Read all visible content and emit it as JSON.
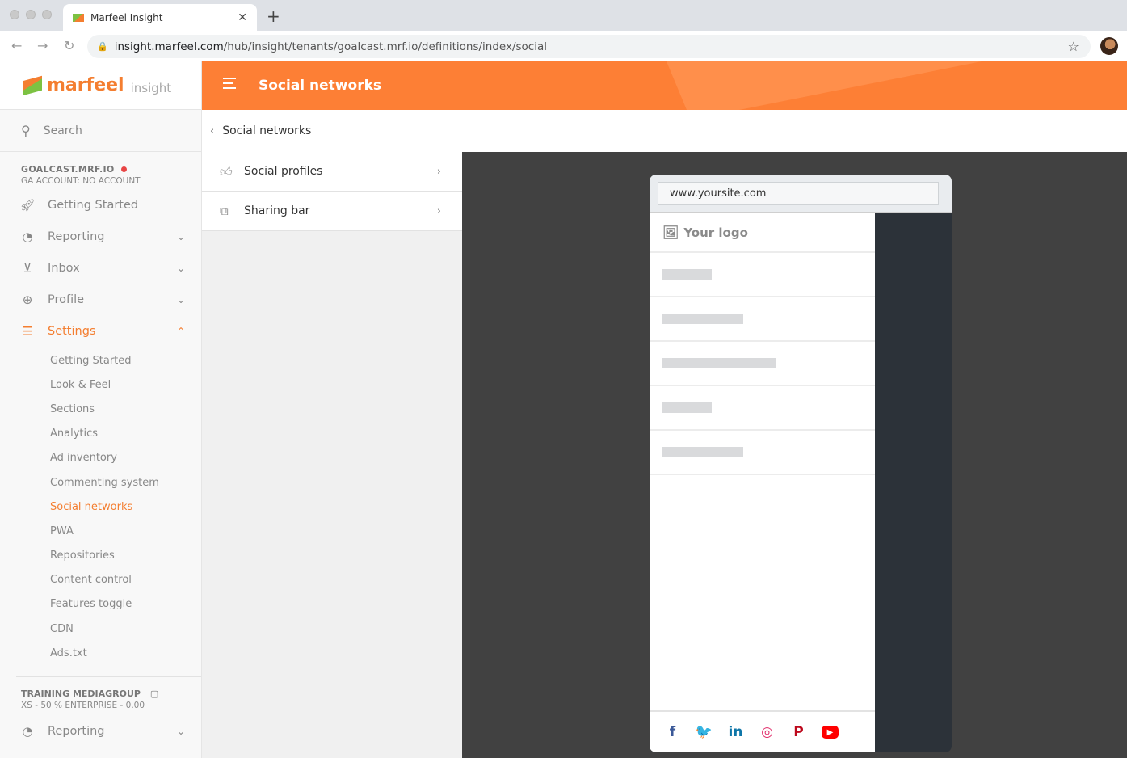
{
  "browser": {
    "tab_title": "Marfeel Insight",
    "url_host": "insight.marfeel.com",
    "url_path": "/hub/insight/tenants/goalcast.mrf.io/definitions/index/social"
  },
  "logo": {
    "brand": "marfeel",
    "product": "insight"
  },
  "sidebar": {
    "search_placeholder": "Search",
    "tenant_name": "GOALCAST.MRF.IO",
    "tenant_ga": "GA ACCOUNT: NO ACCOUNT",
    "items": [
      {
        "label": "Getting Started",
        "icon": "rocket-icon"
      },
      {
        "label": "Reporting",
        "icon": "pie-chart-icon"
      },
      {
        "label": "Inbox",
        "icon": "inbox-icon"
      },
      {
        "label": "Profile",
        "icon": "globe-icon"
      },
      {
        "label": "Settings",
        "icon": "sliders-icon"
      }
    ],
    "settings_children": [
      "Getting Started",
      "Look & Feel",
      "Sections",
      "Analytics",
      "Ad inventory",
      "Commenting system",
      "Social networks",
      "PWA",
      "Repositories",
      "Content control",
      "Features toggle",
      "CDN",
      "Ads.txt"
    ],
    "active_child": "Social networks",
    "org_name": "TRAINING MEDIAGROUP",
    "org_plan": "XS - 50 % ENTERPRISE - 0.00",
    "org_reporting": "Reporting"
  },
  "header": {
    "title": "Social networks"
  },
  "breadcrumb": {
    "label": "Social networks"
  },
  "panel": {
    "items": [
      {
        "label": "Social profiles",
        "icon": "thumbs-up-icon"
      },
      {
        "label": "Sharing bar",
        "icon": "share-icon"
      }
    ]
  },
  "preview": {
    "url": "www.yoursite.com",
    "logo_label": "Your logo",
    "placeholder_bar_fractions": [
      0.22,
      0.36,
      0.5,
      0.22,
      0.36
    ],
    "social_icons": [
      {
        "name": "facebook",
        "color": "#3b5998",
        "glyph": "f"
      },
      {
        "name": "twitter",
        "color": "#1da1f2",
        "glyph": "🐦"
      },
      {
        "name": "linkedin",
        "color": "#0e76a8",
        "glyph": "in"
      },
      {
        "name": "instagram",
        "color": "#e1306c",
        "glyph": "◎"
      },
      {
        "name": "pinterest",
        "color": "#bd081c",
        "glyph": "P"
      },
      {
        "name": "youtube",
        "color": "#ff0000",
        "glyph": "▶"
      }
    ]
  },
  "colors": {
    "accent": "#f47e30",
    "header": "#fd7f35"
  }
}
